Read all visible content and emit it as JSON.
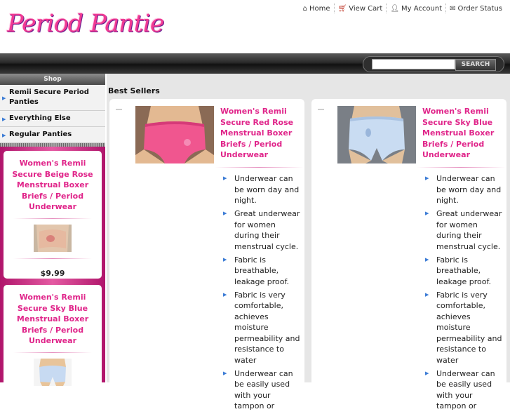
{
  "logo": "Period Pantie",
  "toplinks": [
    {
      "label": "Home",
      "icon": "home-icon"
    },
    {
      "label": "View Cart",
      "icon": "cart-icon"
    },
    {
      "label": "My Account",
      "icon": "account-icon"
    },
    {
      "label": "Order Status",
      "icon": "envelope-icon"
    }
  ],
  "search": {
    "value": "",
    "placeholder": "",
    "button": "SEARCH"
  },
  "sidebar": {
    "heading": "Shop",
    "menu": [
      "Remii Secure Period Panties",
      "Everything Else",
      "Regular Panties"
    ],
    "cards": [
      {
        "title": "Women's Remii Secure Beige Rose Menstrual Boxer Briefs / Period Underwear",
        "price": "$9.99"
      },
      {
        "title": "Women's Remii Secure Sky Blue Menstrual Boxer Briefs / Period Underwear"
      }
    ]
  },
  "main": {
    "heading": "Best Sellers",
    "products": [
      {
        "title": "Women's Remii Secure Red Rose Menstrual Boxer Briefs / Period Underwear",
        "color": "#f0568f",
        "bullets": [
          "Underwear can be worn day and night.",
          "Great underwear for women during their menstrual cycle.",
          "Fabric is breathable, leakage proof.",
          "Fabric is very comfortable, achieves moisture permeability and resistance to water",
          "Underwear can be easily used with your tampon or"
        ]
      },
      {
        "title": "Women's Remii Secure Sky Blue Menstrual Boxer Briefs / Period Underwear",
        "color": "#c9dcf2",
        "bullets": [
          "Underwear can be worn day and night.",
          "Great underwear for women during their menstrual cycle.",
          "Fabric is breathable, leakage proof.",
          "Fabric is very comfortable, achieves moisture permeability and resistance to water",
          "Underwear can be easily used with your tampon or"
        ]
      }
    ]
  },
  "colors": {
    "accent": "#e0258a",
    "sidebar": "#c8287e",
    "bullet": "#3a7bd5"
  }
}
